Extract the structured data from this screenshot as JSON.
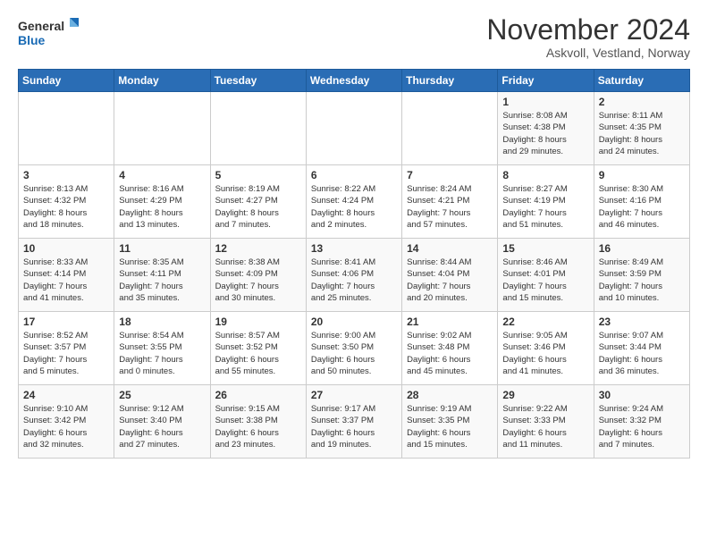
{
  "logo": {
    "line1": "General",
    "line2": "Blue"
  },
  "title": "November 2024",
  "subtitle": "Askvoll, Vestland, Norway",
  "days_of_week": [
    "Sunday",
    "Monday",
    "Tuesday",
    "Wednesday",
    "Thursday",
    "Friday",
    "Saturday"
  ],
  "weeks": [
    [
      {
        "day": "",
        "detail": ""
      },
      {
        "day": "",
        "detail": ""
      },
      {
        "day": "",
        "detail": ""
      },
      {
        "day": "",
        "detail": ""
      },
      {
        "day": "",
        "detail": ""
      },
      {
        "day": "1",
        "detail": "Sunrise: 8:08 AM\nSunset: 4:38 PM\nDaylight: 8 hours\nand 29 minutes."
      },
      {
        "day": "2",
        "detail": "Sunrise: 8:11 AM\nSunset: 4:35 PM\nDaylight: 8 hours\nand 24 minutes."
      }
    ],
    [
      {
        "day": "3",
        "detail": "Sunrise: 8:13 AM\nSunset: 4:32 PM\nDaylight: 8 hours\nand 18 minutes."
      },
      {
        "day": "4",
        "detail": "Sunrise: 8:16 AM\nSunset: 4:29 PM\nDaylight: 8 hours\nand 13 minutes."
      },
      {
        "day": "5",
        "detail": "Sunrise: 8:19 AM\nSunset: 4:27 PM\nDaylight: 8 hours\nand 7 minutes."
      },
      {
        "day": "6",
        "detail": "Sunrise: 8:22 AM\nSunset: 4:24 PM\nDaylight: 8 hours\nand 2 minutes."
      },
      {
        "day": "7",
        "detail": "Sunrise: 8:24 AM\nSunset: 4:21 PM\nDaylight: 7 hours\nand 57 minutes."
      },
      {
        "day": "8",
        "detail": "Sunrise: 8:27 AM\nSunset: 4:19 PM\nDaylight: 7 hours\nand 51 minutes."
      },
      {
        "day": "9",
        "detail": "Sunrise: 8:30 AM\nSunset: 4:16 PM\nDaylight: 7 hours\nand 46 minutes."
      }
    ],
    [
      {
        "day": "10",
        "detail": "Sunrise: 8:33 AM\nSunset: 4:14 PM\nDaylight: 7 hours\nand 41 minutes."
      },
      {
        "day": "11",
        "detail": "Sunrise: 8:35 AM\nSunset: 4:11 PM\nDaylight: 7 hours\nand 35 minutes."
      },
      {
        "day": "12",
        "detail": "Sunrise: 8:38 AM\nSunset: 4:09 PM\nDaylight: 7 hours\nand 30 minutes."
      },
      {
        "day": "13",
        "detail": "Sunrise: 8:41 AM\nSunset: 4:06 PM\nDaylight: 7 hours\nand 25 minutes."
      },
      {
        "day": "14",
        "detail": "Sunrise: 8:44 AM\nSunset: 4:04 PM\nDaylight: 7 hours\nand 20 minutes."
      },
      {
        "day": "15",
        "detail": "Sunrise: 8:46 AM\nSunset: 4:01 PM\nDaylight: 7 hours\nand 15 minutes."
      },
      {
        "day": "16",
        "detail": "Sunrise: 8:49 AM\nSunset: 3:59 PM\nDaylight: 7 hours\nand 10 minutes."
      }
    ],
    [
      {
        "day": "17",
        "detail": "Sunrise: 8:52 AM\nSunset: 3:57 PM\nDaylight: 7 hours\nand 5 minutes."
      },
      {
        "day": "18",
        "detail": "Sunrise: 8:54 AM\nSunset: 3:55 PM\nDaylight: 7 hours\nand 0 minutes."
      },
      {
        "day": "19",
        "detail": "Sunrise: 8:57 AM\nSunset: 3:52 PM\nDaylight: 6 hours\nand 55 minutes."
      },
      {
        "day": "20",
        "detail": "Sunrise: 9:00 AM\nSunset: 3:50 PM\nDaylight: 6 hours\nand 50 minutes."
      },
      {
        "day": "21",
        "detail": "Sunrise: 9:02 AM\nSunset: 3:48 PM\nDaylight: 6 hours\nand 45 minutes."
      },
      {
        "day": "22",
        "detail": "Sunrise: 9:05 AM\nSunset: 3:46 PM\nDaylight: 6 hours\nand 41 minutes."
      },
      {
        "day": "23",
        "detail": "Sunrise: 9:07 AM\nSunset: 3:44 PM\nDaylight: 6 hours\nand 36 minutes."
      }
    ],
    [
      {
        "day": "24",
        "detail": "Sunrise: 9:10 AM\nSunset: 3:42 PM\nDaylight: 6 hours\nand 32 minutes."
      },
      {
        "day": "25",
        "detail": "Sunrise: 9:12 AM\nSunset: 3:40 PM\nDaylight: 6 hours\nand 27 minutes."
      },
      {
        "day": "26",
        "detail": "Sunrise: 9:15 AM\nSunset: 3:38 PM\nDaylight: 6 hours\nand 23 minutes."
      },
      {
        "day": "27",
        "detail": "Sunrise: 9:17 AM\nSunset: 3:37 PM\nDaylight: 6 hours\nand 19 minutes."
      },
      {
        "day": "28",
        "detail": "Sunrise: 9:19 AM\nSunset: 3:35 PM\nDaylight: 6 hours\nand 15 minutes."
      },
      {
        "day": "29",
        "detail": "Sunrise: 9:22 AM\nSunset: 3:33 PM\nDaylight: 6 hours\nand 11 minutes."
      },
      {
        "day": "30",
        "detail": "Sunrise: 9:24 AM\nSunset: 3:32 PM\nDaylight: 6 hours\nand 7 minutes."
      }
    ]
  ]
}
